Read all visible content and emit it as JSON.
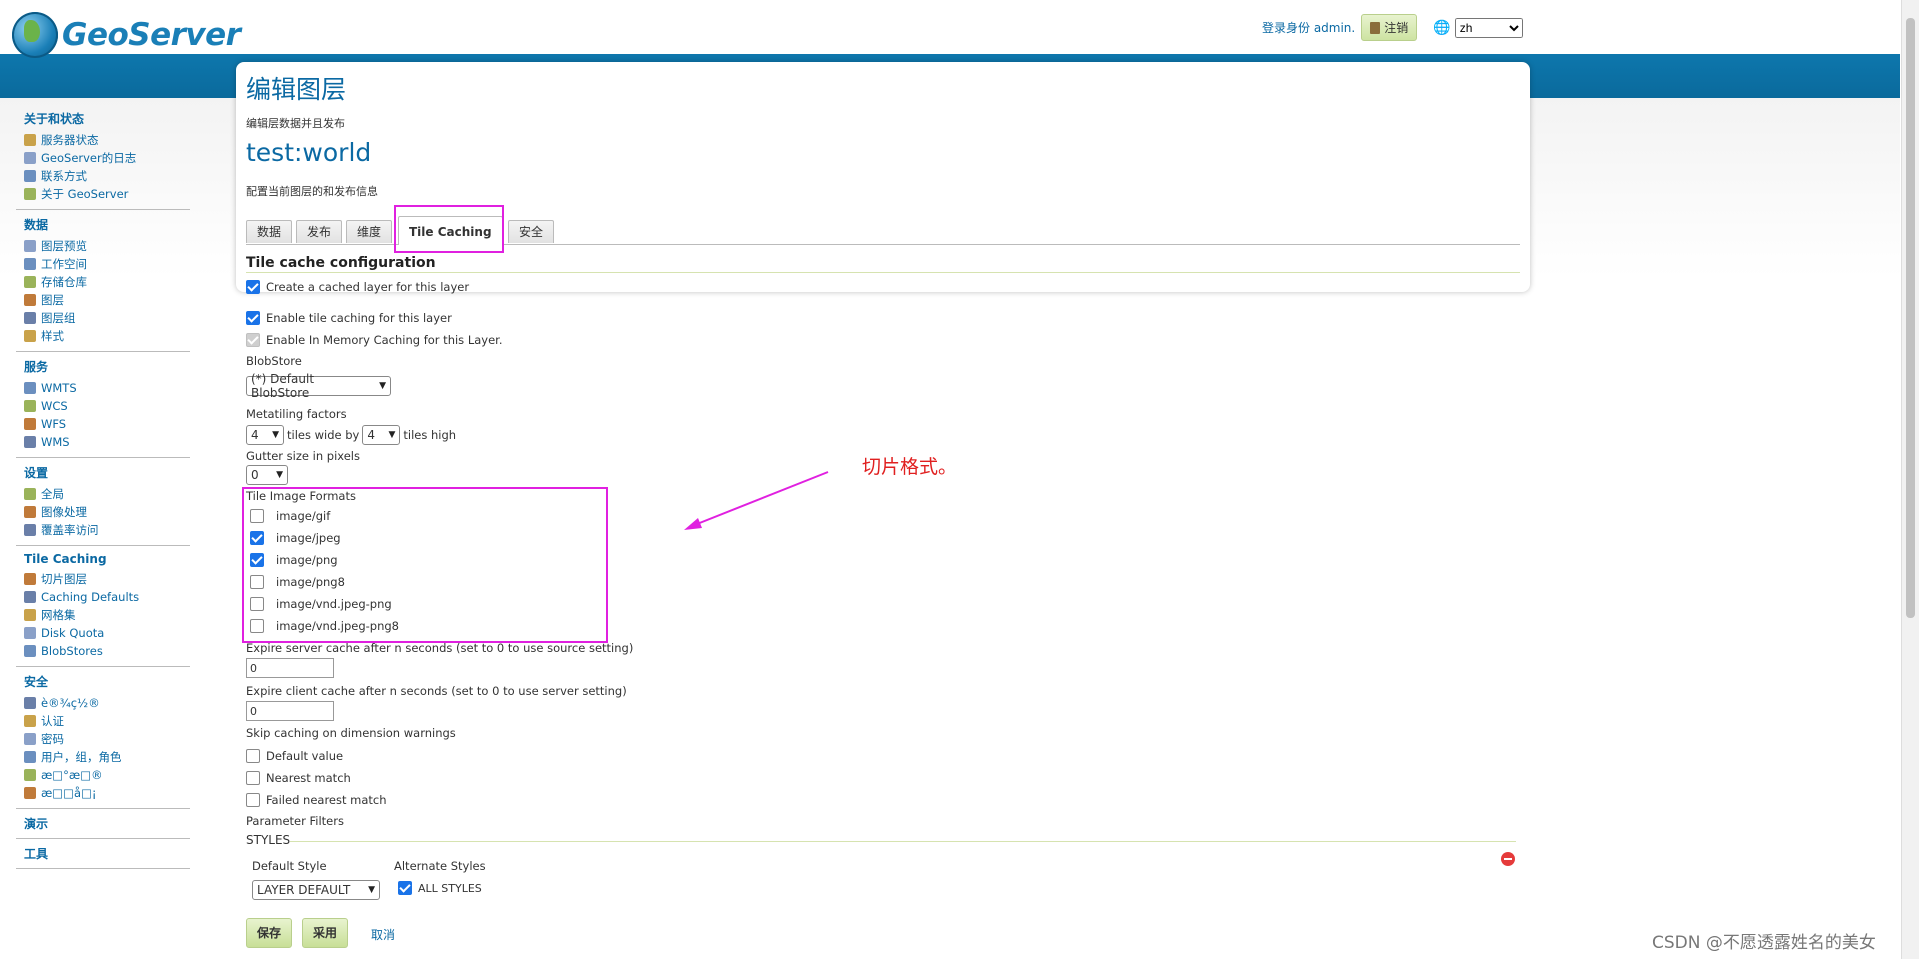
{
  "app": {
    "logo_text": "GeoServer"
  },
  "user": {
    "logged_in_as": "登录身份 admin.",
    "logout_label": "注销",
    "language": "zh"
  },
  "sidebar": {
    "sections": [
      {
        "title": "关于和状态",
        "items": [
          "服务器状态",
          "GeoServer的日志",
          "联系方式",
          "关于 GeoServer"
        ]
      },
      {
        "title": "数据",
        "items": [
          "图层预览",
          "工作空间",
          "存储仓库",
          "图层",
          "图层组",
          "样式"
        ]
      },
      {
        "title": "服务",
        "items": [
          "WMTS",
          "WCS",
          "WFS",
          "WMS"
        ]
      },
      {
        "title": "设置",
        "items": [
          "全局",
          "图像处理",
          "覆盖率访问"
        ]
      },
      {
        "title": "Tile Caching",
        "items": [
          "切片图层",
          "Caching Defaults",
          "网格集",
          "Disk Quota",
          "BlobStores"
        ]
      },
      {
        "title": "安全",
        "items": [
          "è®¾ç½®",
          "认证",
          "密码",
          "用户，组，角色",
          "æ□°æ□®",
          "æ□□å□¡"
        ]
      },
      {
        "title": "演示",
        "items": []
      },
      {
        "title": "工具",
        "items": []
      }
    ]
  },
  "page": {
    "title": "编辑图层",
    "subtitle": "编辑层数据并且发布",
    "layer_name": "test:world",
    "layer_desc": "配置当前图层的和发布信息",
    "tabs": [
      "数据",
      "发布",
      "维度",
      "Tile Caching",
      "安全"
    ],
    "active_tab": "Tile Caching"
  },
  "tile_cache": {
    "section_title": "Tile cache configuration",
    "create_cached": "Create a cached layer for this layer",
    "enable_caching": "Enable tile caching for this layer",
    "in_memory": "Enable In Memory Caching for this Layer.",
    "blobstore_label": "BlobStore",
    "blobstore_value": "(*) Default BlobStore",
    "metatiling_label": "Metatiling factors",
    "meta_w": "4",
    "tiles_wide_by": "tiles wide by",
    "meta_h": "4",
    "tiles_high": "tiles high",
    "gutter_label": "Gutter size in pixels",
    "gutter_value": "0",
    "formats_label": "Tile Image Formats",
    "formats": [
      {
        "name": "image/gif",
        "checked": false
      },
      {
        "name": "image/jpeg",
        "checked": true
      },
      {
        "name": "image/png",
        "checked": true
      },
      {
        "name": "image/png8",
        "checked": false
      },
      {
        "name": "image/vnd.jpeg-png",
        "checked": false
      },
      {
        "name": "image/vnd.jpeg-png8",
        "checked": false
      }
    ],
    "expire_server_label": "Expire server cache after n seconds (set to 0 to use source setting)",
    "expire_server_value": "0",
    "expire_client_label": "Expire client cache after n seconds (set to 0 to use server setting)",
    "expire_client_value": "0",
    "skip_label": "Skip caching on dimension warnings",
    "skip_options": [
      "Default value",
      "Nearest match",
      "Failed nearest match"
    ],
    "param_filters_label": "Parameter Filters",
    "styles_label": "STYLES",
    "default_style_label": "Default Style",
    "default_style_value": "LAYER DEFAULT",
    "alternate_styles_label": "Alternate Styles",
    "all_styles": "ALL STYLES"
  },
  "annotation": {
    "text": "切片格式。",
    "color": "#e02020"
  },
  "buttons": {
    "save": "保存",
    "apply": "采用",
    "cancel": "取消"
  },
  "watermark": "CSDN @不愿透露姓名的美女"
}
